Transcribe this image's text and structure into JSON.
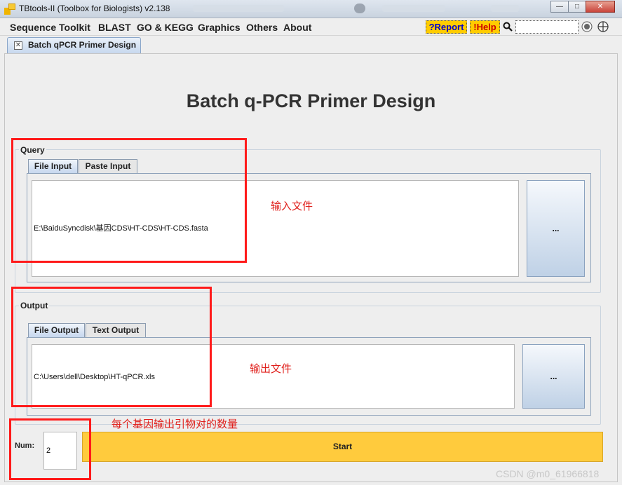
{
  "window": {
    "title": "TBtools-II (Toolbox for Biologists) v2.138",
    "buttons": {
      "minimize": "—",
      "maximize": "□",
      "close": "✕"
    }
  },
  "menu": {
    "items": [
      "Sequence Toolkit",
      "BLAST",
      "GO & KEGG",
      "Graphics",
      "Others",
      "About"
    ],
    "report_label": "?Report",
    "help_label": "!Help",
    "search_value": ""
  },
  "doc_tab": {
    "label": "Batch qPCR Primer Design",
    "close_glyph": "✕"
  },
  "page": {
    "title": "Batch q-PCR Primer Design"
  },
  "query": {
    "legend": "Query",
    "tabs": [
      "File Input",
      "Paste Input"
    ],
    "active_tab": "File Input",
    "file_path": "E:\\BaiduSyncdisk\\基因CDS\\HT-CDS\\HT-CDS.fasta",
    "browse_label": "..."
  },
  "output": {
    "legend": "Output",
    "tabs": [
      "File Output",
      "Text Output"
    ],
    "active_tab": "File Output",
    "file_path": "C:\\Users\\dell\\Desktop\\HT-qPCR.xls",
    "browse_label": "..."
  },
  "num": {
    "label": "Num:",
    "value": "2"
  },
  "start": {
    "label": "Start"
  },
  "annotations": {
    "input_note": "输入文件",
    "output_note": "输出文件",
    "num_note": "每个基因输出引物对的数量",
    "color": "#ff1a1a"
  },
  "watermark": "CSDN @m0_61966818",
  "colors": {
    "accent_yellow": "#ffcc00",
    "start_yellow": "#ffcb3d",
    "report_text": "#0000cc",
    "help_text": "#cc0000"
  }
}
